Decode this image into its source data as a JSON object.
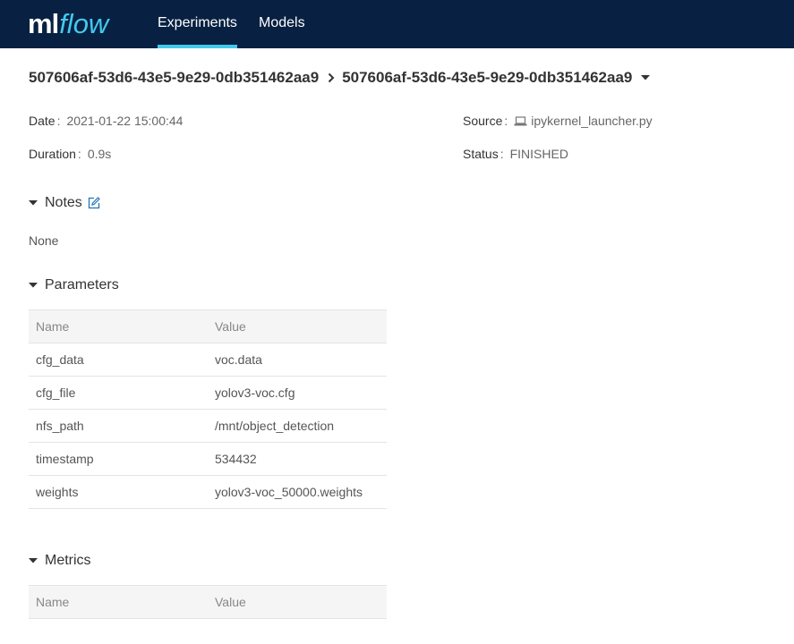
{
  "nav": {
    "logo_ml": "ml",
    "logo_flow": "flow",
    "items": [
      "Experiments",
      "Models"
    ]
  },
  "breadcrumb": {
    "experiment": "507606af-53d6-43e5-9e29-0db351462aa9",
    "run": "507606af-53d6-43e5-9e29-0db351462aa9"
  },
  "meta": {
    "date_label": "Date",
    "date_value": "2021-01-22 15:00:44",
    "duration_label": "Duration",
    "duration_value": "0.9s",
    "source_label": "Source",
    "source_value": "ipykernel_launcher.py",
    "status_label": "Status",
    "status_value": "FINISHED"
  },
  "notes": {
    "title": "Notes",
    "body": "None"
  },
  "parameters": {
    "title": "Parameters",
    "headers": [
      "Name",
      "Value"
    ],
    "rows": [
      [
        "cfg_data",
        "voc.data"
      ],
      [
        "cfg_file",
        "yolov3-voc.cfg"
      ],
      [
        "nfs_path",
        "/mnt/object_detection"
      ],
      [
        "timestamp",
        "534432"
      ],
      [
        "weights",
        "yolov3-voc_50000.weights"
      ]
    ]
  },
  "metrics": {
    "title": "Metrics",
    "headers": [
      "Name",
      "Value"
    ]
  },
  "colors": {
    "navbar": "#082142",
    "accent": "#43c9ed",
    "link": "#2374bb"
  },
  "icons": {
    "breadcrumb_separator": "chevron-right-icon",
    "run_menu": "caret-down-icon",
    "source": "laptop-icon",
    "notes_edit": "edit-icon",
    "section_toggle": "caret-down-icon"
  }
}
